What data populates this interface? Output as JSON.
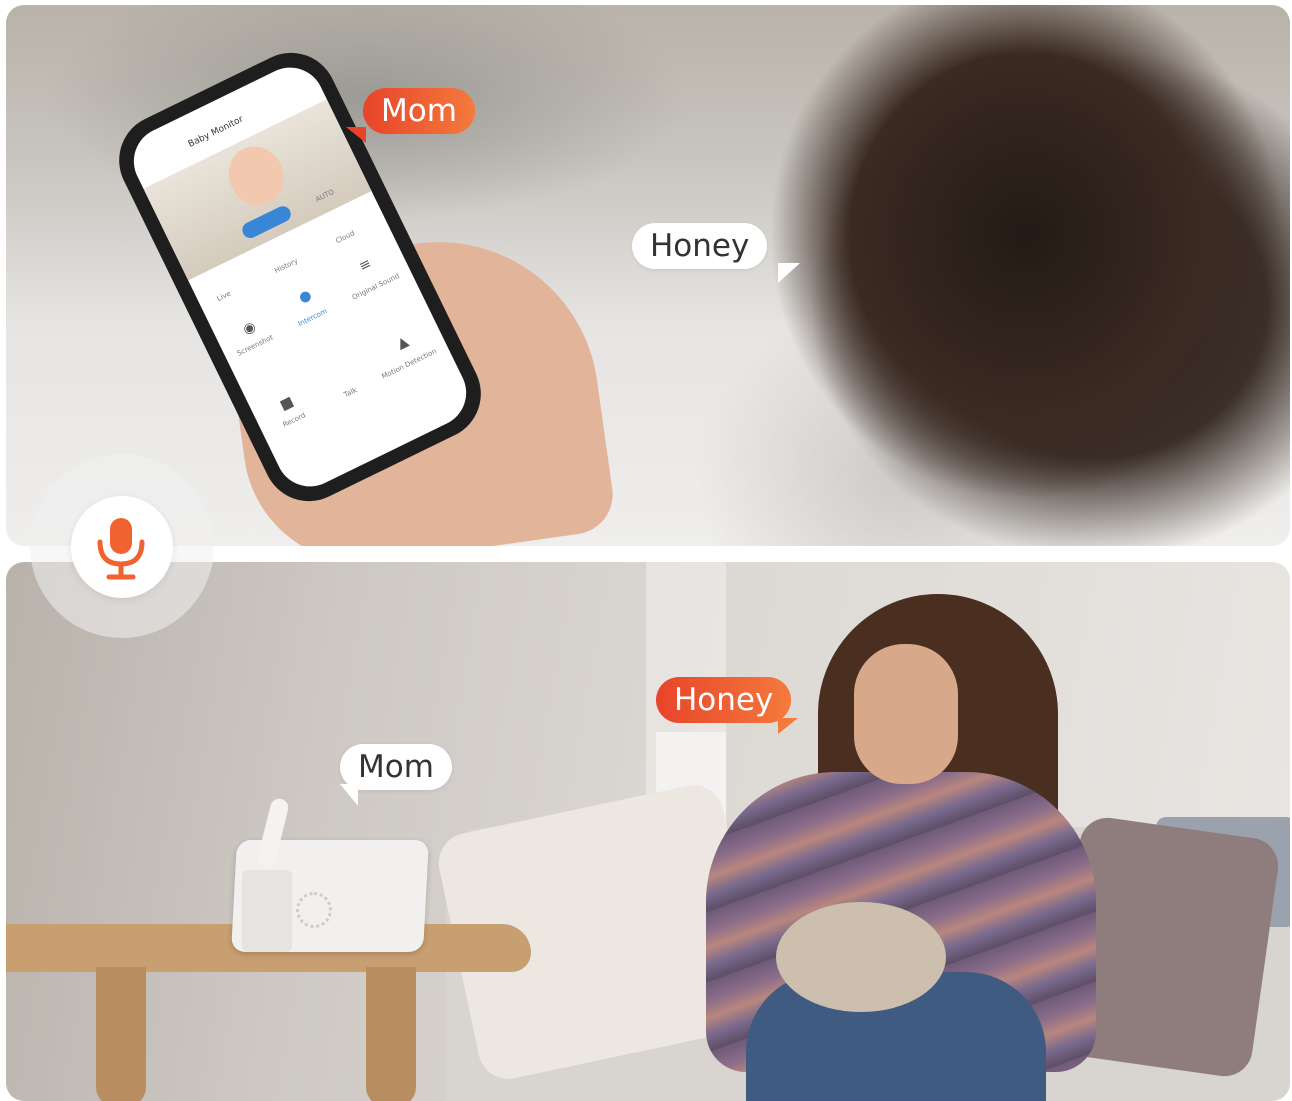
{
  "bubbles": {
    "top_mom": "Mom",
    "top_honey": "Honey",
    "bottom_mom": "Mom",
    "bottom_honey": "Honey"
  },
  "phone_app": {
    "title": "Baby Monitor",
    "quality": "AUTO",
    "tabs": [
      "Live",
      "History",
      "Cloud"
    ],
    "controls": [
      "Screenshot",
      "Intercom",
      "Original Sound",
      "Record",
      "Talk",
      "Motion Detection"
    ]
  },
  "colors": {
    "accent_orange": "#f0622f",
    "bubble_white": "#ffffff"
  },
  "icons": {
    "badge": "microphone-icon"
  }
}
